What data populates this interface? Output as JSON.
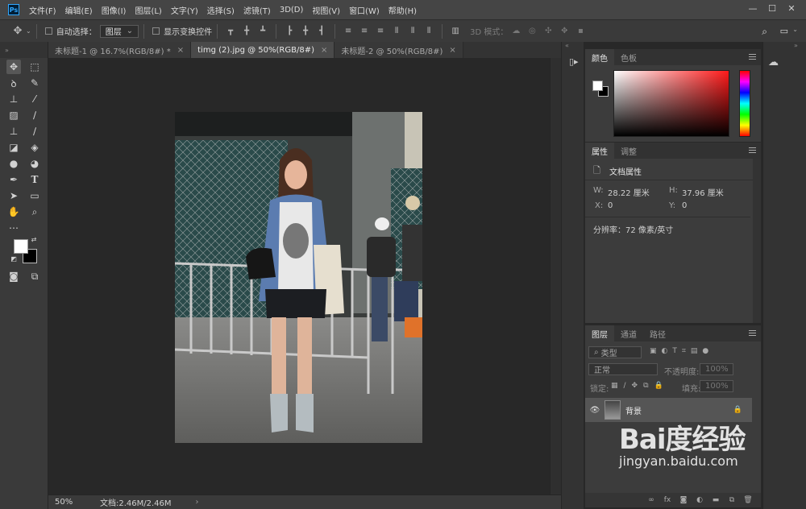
{
  "menubar": {
    "logo": "Ps",
    "items": [
      "文件(F)",
      "编辑(E)",
      "图像(I)",
      "图层(L)",
      "文字(Y)",
      "选择(S)",
      "滤镜(T)",
      "3D(D)",
      "视图(V)",
      "窗口(W)",
      "帮助(H)"
    ],
    "window_controls": [
      "—",
      "☐",
      "✕"
    ]
  },
  "options": {
    "auto_select_label": "自动选择：",
    "auto_select_value": "图层",
    "show_transform_label": "显示变换控件",
    "mode_3d_label": "3D 模式："
  },
  "tabs": [
    {
      "label": "未标题-1 @ 16.7%(RGB/8#) *",
      "close": "×"
    },
    {
      "label": "timg (2).jpg @ 50%(RGB/8#)",
      "close": "×"
    },
    {
      "label": "未标题-2 @ 50%(RGB/8#)",
      "close": "×"
    }
  ],
  "active_tab": 1,
  "status": {
    "zoom": "50%",
    "doc": "文档:2.46M/2.46M",
    "arrow": "›"
  },
  "color_panel": {
    "tabs": [
      "颜色",
      "色板"
    ]
  },
  "properties_panel": {
    "tabs": [
      "属性",
      "调整"
    ],
    "heading": "文档属性",
    "w_label": "W:",
    "w_value": "28.22 厘米",
    "h_label": "H:",
    "h_value": "37.96 厘米",
    "x_label": "X:",
    "x_value": "0",
    "y_label": "Y:",
    "y_value": "0",
    "resolution": "分辨率：72 像素/英寸"
  },
  "layers_panel": {
    "tabs": [
      "图层",
      "通道",
      "路径"
    ],
    "filter_label": "类型",
    "blend_mode": "正常",
    "opacity_label": "不透明度:",
    "opacity_value": "100%",
    "lock_label": "锁定:",
    "fill_label": "填充:",
    "fill_value": "100%",
    "layer_name": "背景"
  },
  "watermark": {
    "brand": "Bai度经验",
    "url": "jingyan.baidu.com"
  },
  "colors": {
    "foreground": "#ffffff",
    "background": "#000000",
    "accent": "#31a8ff"
  }
}
